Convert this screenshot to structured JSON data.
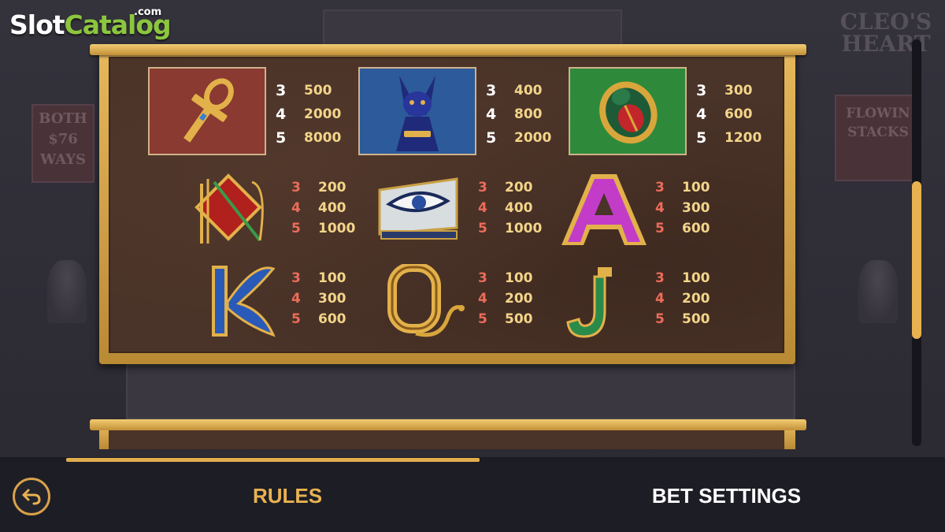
{
  "watermark": {
    "part1": "Slot",
    "part2": "Catalog",
    "part3": ".com"
  },
  "background": {
    "ways_text": [
      "BOTH",
      "$76",
      "WAYS"
    ],
    "feature_text": [
      "FLOWIN",
      "STACKS"
    ],
    "title_text": [
      "CLEO'S",
      "HEART"
    ]
  },
  "paytable": {
    "high_symbols": [
      {
        "symbol": "ankh",
        "pays": [
          {
            "count": "3",
            "amount": "500"
          },
          {
            "count": "4",
            "amount": "2000"
          },
          {
            "count": "5",
            "amount": "8000"
          }
        ]
      },
      {
        "symbol": "cat",
        "pays": [
          {
            "count": "3",
            "amount": "400"
          },
          {
            "count": "4",
            "amount": "800"
          },
          {
            "count": "5",
            "amount": "2000"
          }
        ]
      },
      {
        "symbol": "scarab",
        "pays": [
          {
            "count": "3",
            "amount": "300"
          },
          {
            "count": "4",
            "amount": "600"
          },
          {
            "count": "5",
            "amount": "1200"
          }
        ]
      }
    ],
    "mid_symbols": [
      {
        "symbol": "crook-and-flail",
        "pays": [
          {
            "count": "3",
            "amount": "200"
          },
          {
            "count": "4",
            "amount": "400"
          },
          {
            "count": "5",
            "amount": "1000"
          }
        ]
      },
      {
        "symbol": "eye-of-horus",
        "pays": [
          {
            "count": "3",
            "amount": "200"
          },
          {
            "count": "4",
            "amount": "400"
          },
          {
            "count": "5",
            "amount": "1000"
          }
        ]
      },
      {
        "symbol": "letter-a",
        "letter": "A",
        "pays": [
          {
            "count": "3",
            "amount": "100"
          },
          {
            "count": "4",
            "amount": "300"
          },
          {
            "count": "5",
            "amount": "600"
          }
        ]
      }
    ],
    "low_symbols": [
      {
        "symbol": "letter-k",
        "letter": "K",
        "pays": [
          {
            "count": "3",
            "amount": "100"
          },
          {
            "count": "4",
            "amount": "300"
          },
          {
            "count": "5",
            "amount": "600"
          }
        ]
      },
      {
        "symbol": "letter-q",
        "letter": "Q",
        "pays": [
          {
            "count": "3",
            "amount": "100"
          },
          {
            "count": "4",
            "amount": "200"
          },
          {
            "count": "5",
            "amount": "500"
          }
        ]
      },
      {
        "symbol": "letter-j",
        "letter": "J",
        "pays": [
          {
            "count": "3",
            "amount": "100"
          },
          {
            "count": "4",
            "amount": "200"
          },
          {
            "count": "5",
            "amount": "500"
          }
        ]
      }
    ]
  },
  "page_progress": 0.47,
  "bottom_bar": {
    "back_icon": "back-arrow-icon",
    "tabs": [
      {
        "label": "RULES",
        "active": true
      },
      {
        "label": "BET SETTINGS",
        "active": false
      }
    ]
  },
  "colors": {
    "accent_gold": "#e8b250",
    "pay_count_red": "#ec6c5a",
    "pay_amount_gold": "#f3d58a",
    "panel_brown": "#4a3328"
  }
}
